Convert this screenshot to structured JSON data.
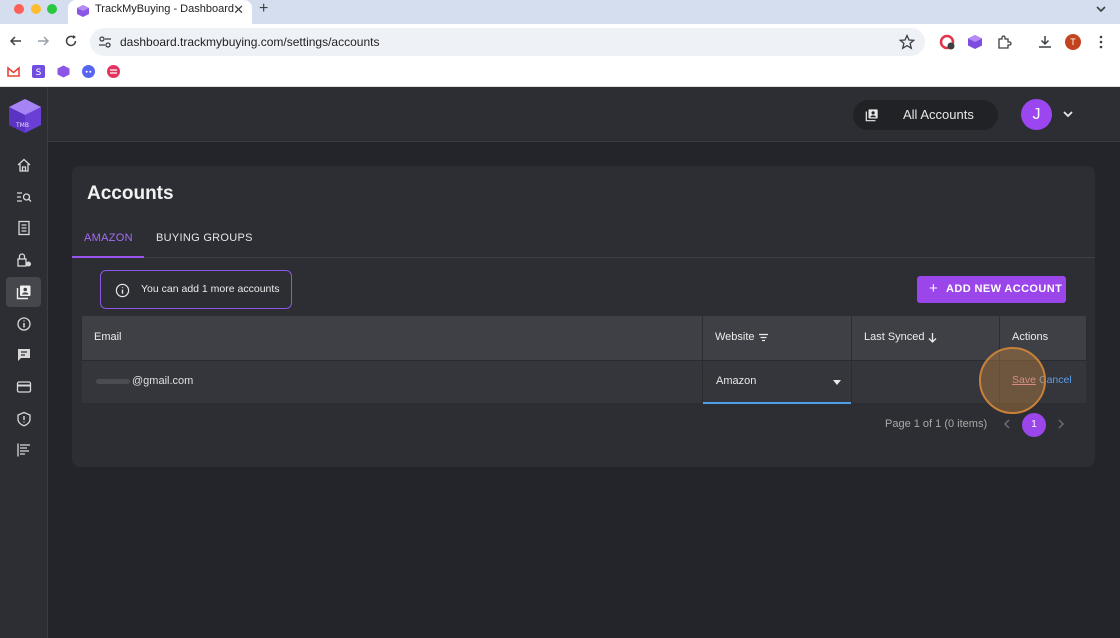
{
  "browser": {
    "tab_title": "TrackMyBuying - Dashboard",
    "url": "dashboard.trackmybuying.com/settings/accounts",
    "profile_initial": "T"
  },
  "header": {
    "account_selector": "All Accounts",
    "avatar_initial": "J"
  },
  "sidebar": {
    "items": [
      "home-icon",
      "search-list-icon",
      "document-icon",
      "lock-settings-icon",
      "accounts-icon",
      "info-icon",
      "feedback-icon",
      "credit-card-icon",
      "shield-icon",
      "report-icon"
    ],
    "active": "accounts-icon"
  },
  "page": {
    "title": "Accounts",
    "tabs": [
      {
        "label": "AMAZON",
        "active": true
      },
      {
        "label": "BUYING GROUPS",
        "active": false
      }
    ],
    "info_message": "You can add 1 more accounts",
    "add_button": "ADD NEW ACCOUNT"
  },
  "table": {
    "columns": [
      "Email",
      "Website",
      "Last Synced",
      "Actions"
    ],
    "rows": [
      {
        "email": "@gmail.com",
        "website": "Amazon",
        "last_synced": "",
        "actions": {
          "save": "Save",
          "cancel": "Cancel"
        }
      }
    ]
  },
  "pagination": {
    "summary": "Page 1 of 1 (0 items)",
    "current_page": "1"
  },
  "colors": {
    "accent": "#9a46ea",
    "background": "#23252b",
    "card": "#2c2e33"
  }
}
